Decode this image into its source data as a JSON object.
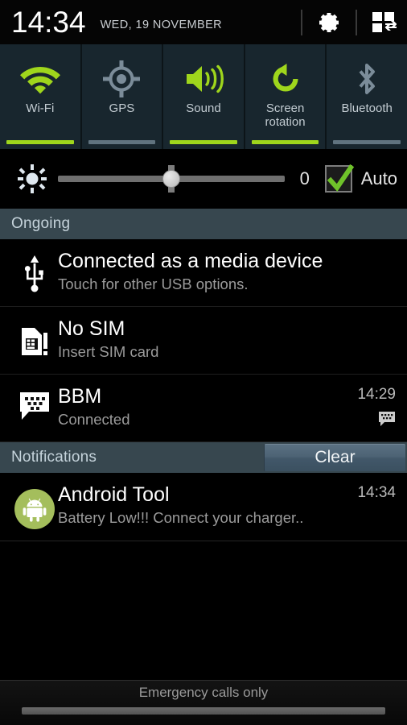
{
  "statusbar": {
    "clock": "14:34",
    "date": "WED, 19 NOVEMBER",
    "settings_icon": "gear-icon",
    "panel_switch_icon": "grid-swap-icon"
  },
  "quick_toggles": [
    {
      "label": "Wi-Fi",
      "icon": "wifi-icon",
      "state": "on"
    },
    {
      "label": "GPS",
      "icon": "gps-target-icon",
      "state": "off"
    },
    {
      "label": "Sound",
      "icon": "speaker-sound-icon",
      "state": "on"
    },
    {
      "label": "Screen\nrotation",
      "icon": "screen-rotation-icon",
      "state": "on"
    },
    {
      "label": "Bluetooth",
      "icon": "bluetooth-icon",
      "state": "off"
    }
  ],
  "brightness": {
    "icon": "brightness-sun-icon",
    "value": "0",
    "slider_percent": 50,
    "auto_label": "Auto",
    "auto_checked": true,
    "check_icon": "checkmark-icon"
  },
  "sections": {
    "ongoing": {
      "title": "Ongoing"
    },
    "notifications": {
      "title": "Notifications",
      "clear_label": "Clear"
    }
  },
  "ongoing_items": [
    {
      "icon": "usb-icon",
      "title": "Connected as a media device",
      "subtitle": "Touch for other USB options.",
      "time": "",
      "badge": ""
    },
    {
      "icon": "sim-card-alert-icon",
      "title": "No SIM",
      "subtitle": "Insert SIM card",
      "time": "",
      "badge": ""
    },
    {
      "icon": "bbm-chat-icon",
      "title": "BBM",
      "subtitle": "Connected",
      "time": "14:29",
      "badge": "bbm-small-chat-icon"
    }
  ],
  "notification_items": [
    {
      "icon": "android-robot-icon",
      "title": "Android Tool",
      "subtitle": "Battery Low!!! Connect your charger..",
      "time": "14:34",
      "badge": ""
    }
  ],
  "bottom": {
    "carrier_status": "Emergency calls only",
    "handle": "drag-handle"
  },
  "colors": {
    "accent_green": "#9fd61c",
    "toggle_off": "#7b8c99",
    "section_header_bg": "#37474f",
    "tile_bg": "#18262e",
    "app_icon_bg": "#a4be5c"
  }
}
